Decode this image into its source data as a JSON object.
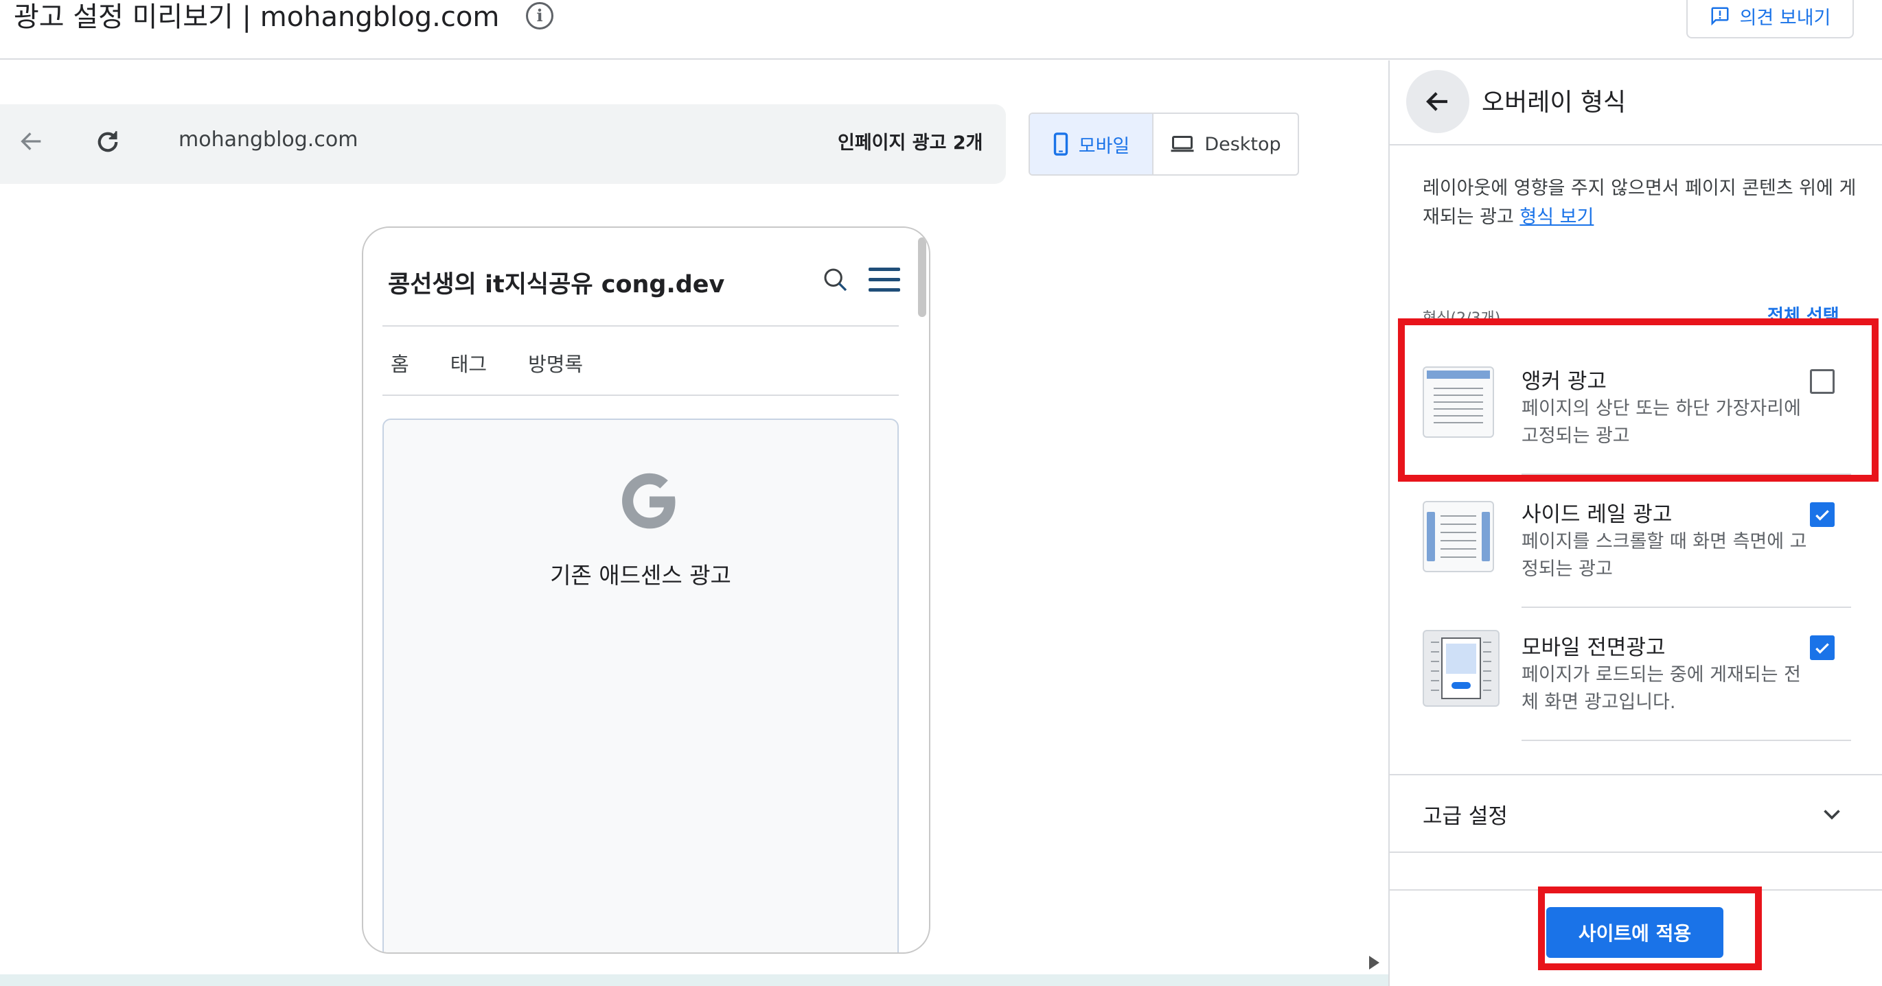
{
  "header": {
    "title": "광고 설정 미리보기 | mohangblog.com",
    "info_icon": "info-icon",
    "feedback_label": "의견 보내기"
  },
  "preview": {
    "url": "mohangblog.com",
    "inpage_ads": "인페이지 광고 2개",
    "device_mobile": "모바일",
    "device_desktop": "Desktop",
    "selected_device": "모바일"
  },
  "blog": {
    "title": "콩선생의 it지식공유 cong.dev",
    "nav": [
      "홈",
      "태그",
      "방명록"
    ],
    "ad_placeholder": "기존 애드센스 광고",
    "ad_logo": "G"
  },
  "panel": {
    "title": "오버레이 형식",
    "description": "레이아웃에 영향을 주지 않으면서 페이지 콘텐츠 위에 게재되는 광고",
    "format_link": "형식 보기",
    "formats_count": "형식(2/3개)",
    "select_all": "전체 선택",
    "formats": [
      {
        "name": "앵커 광고",
        "description": "페이지의 상단 또는 하단 가장자리에 고정되는 광고",
        "checked": false,
        "icon": "anchor-ad-icon"
      },
      {
        "name": "사이드 레일 광고",
        "description": "페이지를 스크롤할 때 화면 측면에 고정되는 광고",
        "checked": true,
        "icon": "side-rail-ad-icon"
      },
      {
        "name": "모바일 전면광고",
        "description": "페이지가 로드되는 중에 게재되는 전체 화면 광고입니다.",
        "checked": true,
        "icon": "vignette-ad-icon"
      }
    ],
    "advanced": "고급 설정",
    "apply": "사이트에 적용"
  },
  "colors": {
    "accent": "#1a73e8",
    "highlight": "#e8141b",
    "checkbox_checked": "#1a73e8"
  }
}
